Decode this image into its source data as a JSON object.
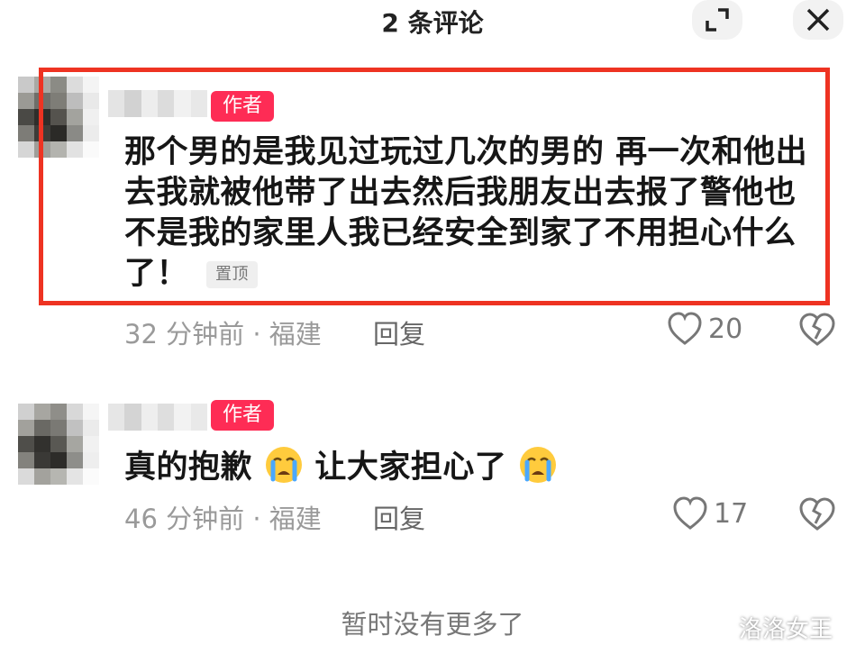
{
  "header": {
    "title": "2 条评论",
    "expand_icon": "expand-icon",
    "close_icon": "close-icon"
  },
  "comments": [
    {
      "badge": "作者",
      "text": "那个男的是我见过玩过几次的男的 再一次和他出去我就被他带了出去然后我朋友出去报了警他也不是我的家里人我已经安全到家了不用担心什么了！",
      "pinned_label": "置顶",
      "meta": "32 分钟前 · 福建",
      "reply": "回复",
      "likes": "20"
    },
    {
      "badge": "作者",
      "text_a": "真的抱歉",
      "text_b": "让大家担心了",
      "emoji": "crying-face",
      "meta": "46 分钟前 · 福建",
      "reply": "回复",
      "likes": "17"
    }
  ],
  "footer": "暂时没有更多了",
  "watermark": "洛洛女王",
  "colors": {
    "badge": "#fe2c55",
    "highlight_border": "#ee3322"
  }
}
